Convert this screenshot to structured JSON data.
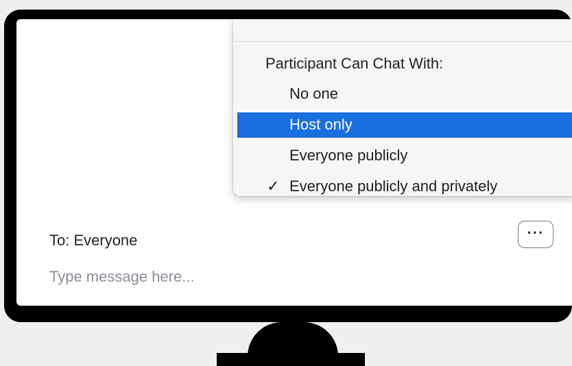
{
  "chat": {
    "to_label": "To: Everyone",
    "message_placeholder": "Type message here...",
    "more_button_label": "···"
  },
  "menu": {
    "header": "Participant Can Chat With:",
    "items": [
      {
        "label": "No one",
        "selected": false,
        "checked": false
      },
      {
        "label": "Host only",
        "selected": true,
        "checked": false
      },
      {
        "label": "Everyone publicly",
        "selected": false,
        "checked": false
      },
      {
        "label": "Everyone publicly and privately",
        "selected": false,
        "checked": true
      }
    ],
    "check_glyph": "✓"
  },
  "colors": {
    "highlight": "#1a6fe0",
    "monitor": "#000000",
    "background": "#efefef"
  }
}
